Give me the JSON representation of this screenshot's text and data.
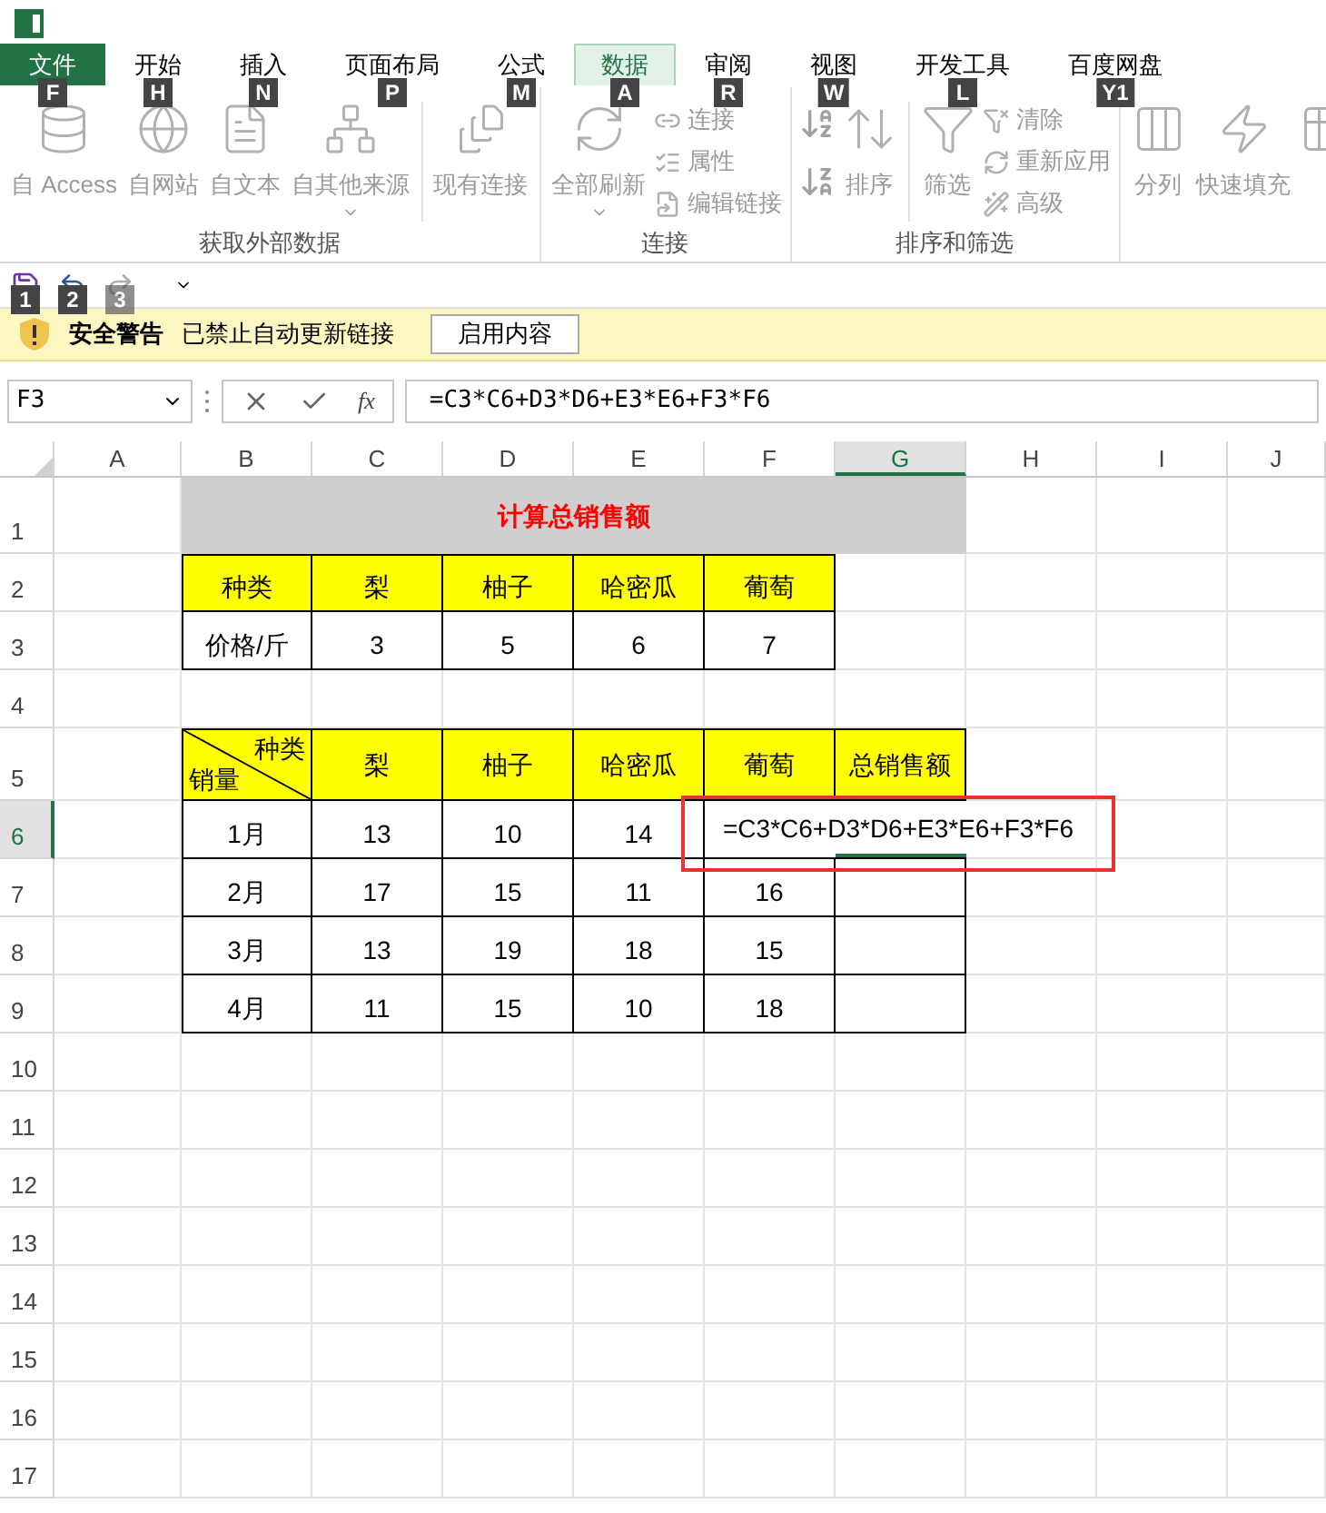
{
  "tabs": [
    {
      "label": "文件",
      "key_tip": "F",
      "kind": "file",
      "selected": false
    },
    {
      "label": "开始",
      "key_tip": "H",
      "kind": "tab",
      "selected": false
    },
    {
      "label": "插入",
      "key_tip": "N",
      "kind": "tab",
      "selected": false
    },
    {
      "label": "页面布局",
      "key_tip": "P",
      "kind": "tab",
      "selected": false
    },
    {
      "label": "公式",
      "key_tip": "M",
      "kind": "tab",
      "selected": false
    },
    {
      "label": "数据",
      "key_tip": "A",
      "kind": "tab",
      "selected": true
    },
    {
      "label": "审阅",
      "key_tip": "R",
      "kind": "tab",
      "selected": false
    },
    {
      "label": "视图",
      "key_tip": "W",
      "kind": "tab",
      "selected": false
    },
    {
      "label": "开发工具",
      "key_tip": "L",
      "kind": "tab",
      "selected": false
    },
    {
      "label": "百度网盘",
      "key_tip": "Y1",
      "kind": "tab",
      "selected": false
    }
  ],
  "ribbon": {
    "groups": [
      {
        "label": "获取外部数据",
        "items": [
          {
            "kind": "large",
            "label": "自 Access",
            "dropdown": false
          },
          {
            "kind": "large",
            "label": "自网站",
            "dropdown": false
          },
          {
            "kind": "large",
            "label": "自文本",
            "dropdown": false
          },
          {
            "kind": "large",
            "label": "自其他来源",
            "dropdown": true
          },
          {
            "kind": "separator"
          },
          {
            "kind": "large",
            "label": "现有连接",
            "dropdown": false
          }
        ]
      },
      {
        "label": "连接",
        "items": [
          {
            "kind": "large",
            "label": "全部刷新",
            "dropdown": true
          },
          {
            "kind": "stack",
            "items": [
              {
                "label": "连接"
              },
              {
                "label": "属性"
              },
              {
                "label": "编辑链接"
              }
            ]
          }
        ]
      },
      {
        "label": "排序和筛选",
        "items": [
          {
            "kind": "sort_icons"
          },
          {
            "kind": "large",
            "label": "排序",
            "dropdown": false
          },
          {
            "kind": "separator"
          },
          {
            "kind": "large",
            "label": "筛选",
            "dropdown": false
          },
          {
            "kind": "stack",
            "items": [
              {
                "label": "清除"
              },
              {
                "label": "重新应用"
              },
              {
                "label": "高级"
              }
            ]
          }
        ]
      },
      {
        "items": [
          {
            "kind": "large",
            "label": "分列",
            "dropdown": false
          },
          {
            "kind": "large",
            "label": "快速填充",
            "dropdown": false
          },
          {
            "kind": "cut"
          }
        ]
      }
    ]
  },
  "quick_access": [
    {
      "key_tip": "1"
    },
    {
      "key_tip": "2"
    },
    {
      "key_tip": "3"
    }
  ],
  "security_bar": {
    "title": "安全警告",
    "message": "已禁止自动更新链接",
    "button": "启用内容"
  },
  "formula_bar": {
    "name_box": "F3",
    "fx": "fx",
    "formula": "=C3*C6+D3*D6+E3*E6+F3*F6"
  },
  "sheet": {
    "columns": [
      {
        "label": "A",
        "selected": false
      },
      {
        "label": "B",
        "selected": false
      },
      {
        "label": "C",
        "selected": false
      },
      {
        "label": "D",
        "selected": false
      },
      {
        "label": "E",
        "selected": false
      },
      {
        "label": "F",
        "selected": false
      },
      {
        "label": "G",
        "selected": true
      },
      {
        "label": "H",
        "selected": false
      },
      {
        "label": "I",
        "selected": false
      },
      {
        "label": "J",
        "selected": false
      }
    ],
    "rows": [
      {
        "label": "1",
        "selected": false
      },
      {
        "label": "2",
        "selected": false
      },
      {
        "label": "3",
        "selected": false
      },
      {
        "label": "4",
        "selected": false
      },
      {
        "label": "5",
        "selected": false
      },
      {
        "label": "6",
        "selected": true
      },
      {
        "label": "7",
        "selected": false
      },
      {
        "label": "8",
        "selected": false
      },
      {
        "label": "9",
        "selected": false
      },
      {
        "label": "10",
        "selected": false
      },
      {
        "label": "11",
        "selected": false
      },
      {
        "label": "12",
        "selected": false
      },
      {
        "label": "13",
        "selected": false
      },
      {
        "label": "14",
        "selected": false
      },
      {
        "label": "15",
        "selected": false
      },
      {
        "label": "16",
        "selected": false
      },
      {
        "label": "17",
        "selected": false
      }
    ],
    "title": "计算总销售额",
    "price_table": {
      "header": [
        "种类",
        "梨",
        "柚子",
        "哈密瓜",
        "葡萄"
      ],
      "values": [
        "价格/斤",
        "3",
        "5",
        "6",
        "7"
      ]
    },
    "sales_table": {
      "corner_top": "种类",
      "corner_bottom": "销量",
      "header": [
        "梨",
        "柚子",
        "哈密瓜",
        "葡萄",
        "总销售额"
      ],
      "rows": [
        [
          "1月",
          "13",
          "10",
          "14"
        ],
        [
          "2月",
          "17",
          "15",
          "11",
          "16",
          ""
        ],
        [
          "3月",
          "13",
          "19",
          "18",
          "15",
          ""
        ],
        [
          "4月",
          "11",
          "15",
          "10",
          "18",
          ""
        ]
      ]
    },
    "editing_cell": {
      "formula": "=C3*C6+D3*D6+E3*E6+F3*F6"
    }
  }
}
